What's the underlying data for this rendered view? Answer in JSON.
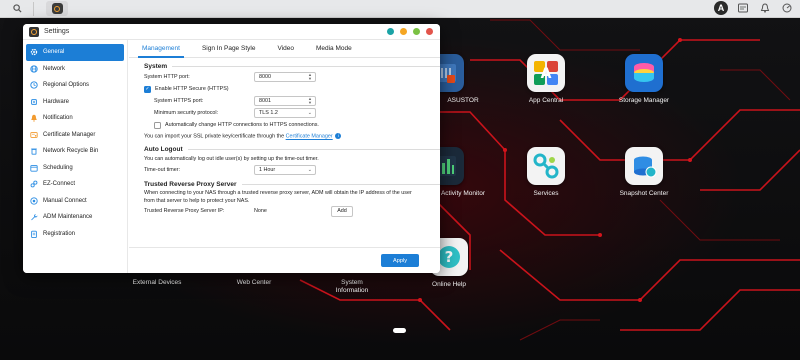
{
  "topbar": {
    "avatar_letter": "A"
  },
  "desktop": {
    "icons": [
      {
        "label": "ASUSTOR"
      },
      {
        "label": "App Central"
      },
      {
        "label": "Storage Manager"
      },
      {
        "label": "Activity Monitor"
      },
      {
        "label": "Services"
      },
      {
        "label": "Snapshot Center"
      },
      {
        "label": "External Devices"
      },
      {
        "label": "Web Center"
      },
      {
        "label": "System Information"
      },
      {
        "label": "Online Help"
      }
    ]
  },
  "window": {
    "title": "Settings",
    "controls": [
      "#1aa3a6",
      "#f5a623",
      "#7ac143",
      "#e2544b"
    ]
  },
  "sidebar": {
    "items": [
      {
        "label": "General",
        "icon": "gear-icon",
        "color": "#ffffff"
      },
      {
        "label": "Network",
        "icon": "globe-icon",
        "color": "#2b8de3"
      },
      {
        "label": "Regional Options",
        "icon": "clock-icon",
        "color": "#2b8de3"
      },
      {
        "label": "Hardware",
        "icon": "chip-icon",
        "color": "#2b8de3"
      },
      {
        "label": "Notification",
        "icon": "bell-icon",
        "color": "#f29b30"
      },
      {
        "label": "Certificate Manager",
        "icon": "certificate-icon",
        "color": "#f29b30"
      },
      {
        "label": "Network Recycle Bin",
        "icon": "trash-icon",
        "color": "#2b8de3"
      },
      {
        "label": "Scheduling",
        "icon": "calendar-icon",
        "color": "#2b8de3"
      },
      {
        "label": "EZ-Connect",
        "icon": "link-icon",
        "color": "#2b8de3"
      },
      {
        "label": "Manual Connect",
        "icon": "plug-icon",
        "color": "#2b8de3"
      },
      {
        "label": "ADM Maintenance",
        "icon": "wrench-icon",
        "color": "#2b8de3"
      },
      {
        "label": "Registration",
        "icon": "clipboard-icon",
        "color": "#2b8de3"
      }
    ]
  },
  "tabs": [
    {
      "label": "Management"
    },
    {
      "label": "Sign In Page Style"
    },
    {
      "label": "Video"
    },
    {
      "label": "Media Mode"
    }
  ],
  "system": {
    "title": "System",
    "http_port_label": "System HTTP port:",
    "http_port_value": "8000",
    "enable_https_label": "Enable HTTP Secure (HTTPS)",
    "https_port_label": "System HTTPS port:",
    "https_port_value": "8001",
    "min_security_label": "Minimum security protocol:",
    "min_security_value": "TLS 1.2",
    "auto_redirect_label": "Automatically change HTTP connections to HTTPS connections.",
    "ssl_text": "You can import your SSL private key/certificate through the",
    "ssl_link": "Certificate Manager"
  },
  "auto_logout": {
    "title": "Auto Logout",
    "desc": "You can automatically log out idle user(s) by setting up the time-out timer.",
    "timer_label": "Time-out timer:",
    "timer_value": "1 Hour"
  },
  "reverse_proxy": {
    "title": "Trusted Reverse Proxy Server",
    "desc_line1": "When connecting to your NAS through a trusted reverse proxy server, ADM will obtain the IP address of the user",
    "desc_line2": "from that server to help to protect your NAS.",
    "server_ip_label": "Trusted Reverse Proxy Server IP:",
    "server_ip_value": "None",
    "add_label": "Add"
  },
  "footer": {
    "apply_label": "Apply"
  },
  "colors": {
    "accent": "#1c7ed6",
    "circuit_red": "#e0141e"
  }
}
